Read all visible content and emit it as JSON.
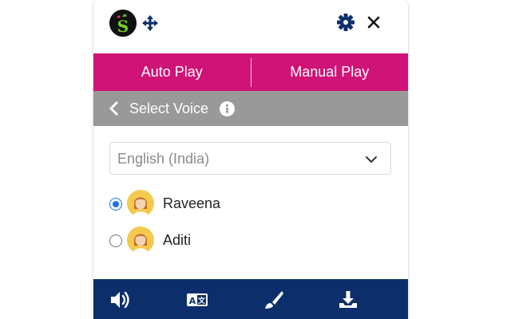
{
  "header": {
    "logo_icon": "s-leaf-logo-icon",
    "move_icon": "move-arrows-icon",
    "settings_icon": "gear-icon",
    "close_icon": "close-icon"
  },
  "mode_tabs": [
    {
      "label": "Auto Play"
    },
    {
      "label": "Manual Play"
    }
  ],
  "voice_section": {
    "title": "Select Voice",
    "back_icon": "chevron-left-icon",
    "info_icon": "info-icon"
  },
  "language_select": {
    "value": "English (India)"
  },
  "voices": [
    {
      "name": "Raveena",
      "selected": true
    },
    {
      "name": "Aditi",
      "selected": false
    }
  ],
  "toolbar": {
    "items": [
      "volume-icon",
      "translate-icon",
      "brush-icon",
      "download-icon"
    ]
  },
  "colors": {
    "accent": "#d01377",
    "section_bar": "#999999",
    "toolbar_bg": "#0c2f6c",
    "icon_blue": "#0c2f6c",
    "radio_selected": "#1a73e8"
  }
}
